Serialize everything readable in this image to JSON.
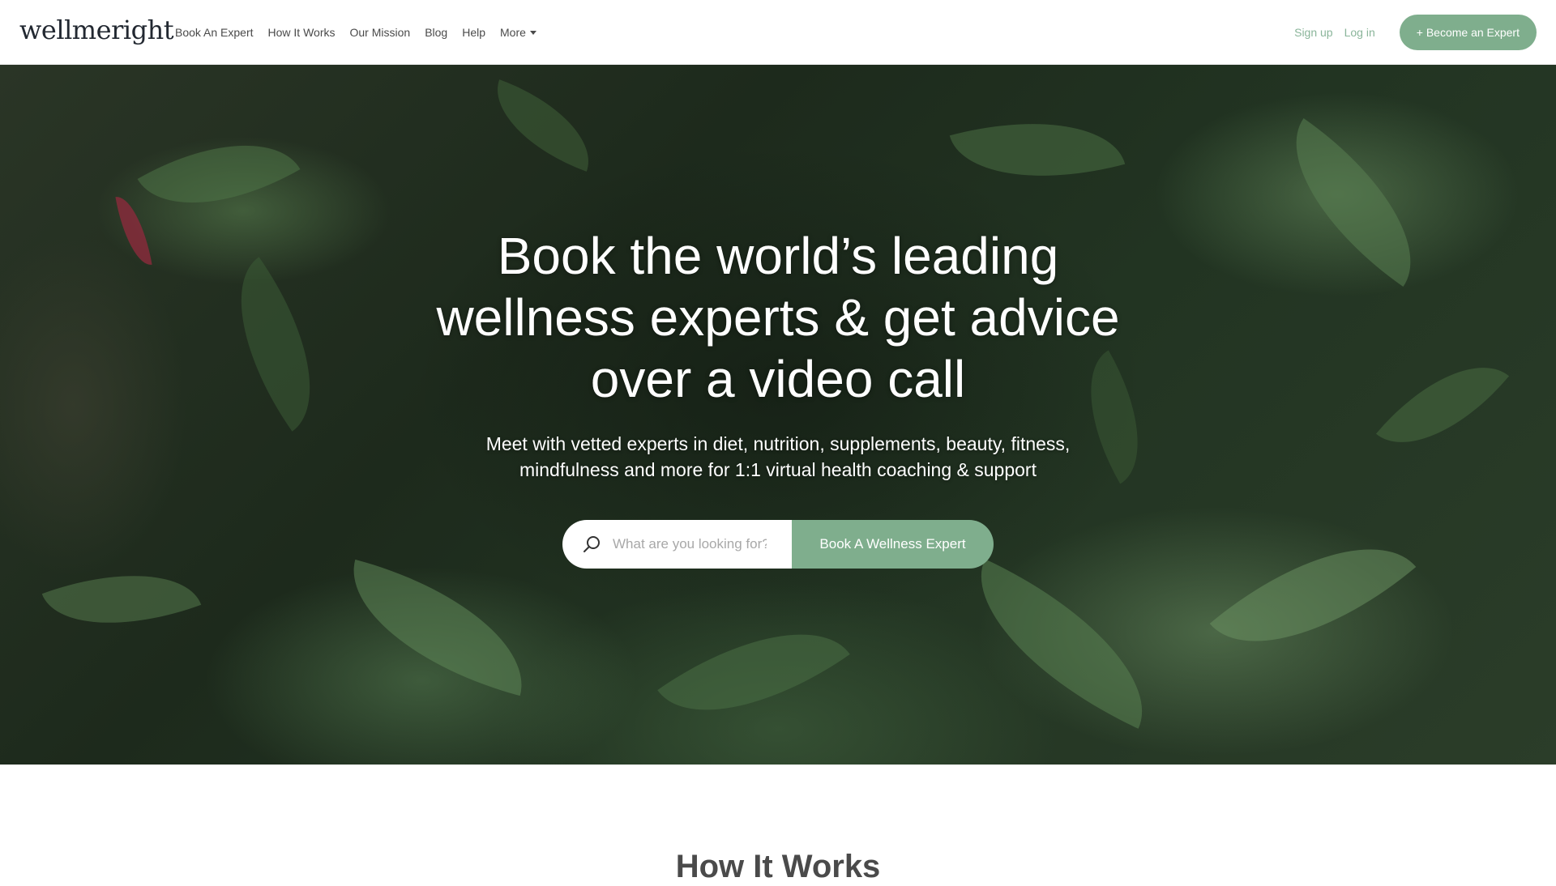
{
  "header": {
    "logo": "wellmeright",
    "nav": [
      {
        "label": "Book An Expert"
      },
      {
        "label": "How It Works"
      },
      {
        "label": "Our Mission"
      },
      {
        "label": "Blog"
      },
      {
        "label": "Help"
      },
      {
        "label": "More"
      }
    ],
    "signup_label": "Sign up",
    "login_label": "Log in",
    "become_expert_label": "+ Become an Expert"
  },
  "hero": {
    "title_lines": [
      "Book the world’s leading",
      "wellness experts & get advice",
      "over a video call"
    ],
    "subtitle_lines": [
      "Meet with vetted experts in diet, nutrition, supplements, beauty, fitness,",
      "mindfulness and more for 1:1 virtual health coaching & support"
    ],
    "search": {
      "placeholder": "What are you looking for?",
      "value": "",
      "icon": "search-icon"
    },
    "book_button_label": "Book A Wellness Expert"
  },
  "sections": {
    "how_it_works_title": "How It Works"
  },
  "colors": {
    "accent": "#7fae8d",
    "link": "#8ab59a",
    "text_dark": "#222831",
    "nav_text": "#4a4a4a"
  }
}
